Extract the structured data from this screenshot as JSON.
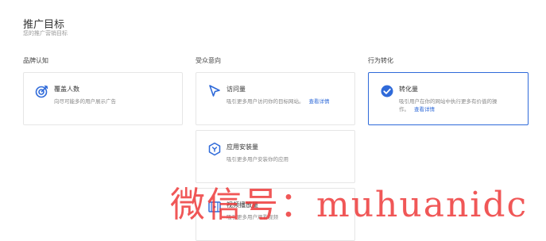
{
  "header": {
    "title": "推广目标",
    "subtitle": "您的推广营销目标"
  },
  "columns": [
    {
      "label": "品牌认知"
    },
    {
      "label": "受众意向"
    },
    {
      "label": "行为转化"
    }
  ],
  "cards": {
    "reach": {
      "title": "覆盖人数",
      "description": "向尽可能多的用户展示广告",
      "icon": "target-icon",
      "selected": false
    },
    "traffic": {
      "title": "访问量",
      "description": "吸引更多用户访问你的目标网站。",
      "link": "查看详情",
      "icon": "cursor-arrow-icon",
      "selected": false
    },
    "conversion": {
      "title": "转化量",
      "description_line1": "吸引用户在你的网站中执行更多有价值的操",
      "description_line2": "作。",
      "link": "查看详情",
      "icon": "check-circle-icon",
      "selected": true
    },
    "app_install": {
      "title": "应用安装量",
      "description": "吸引更多用户安装你的应用",
      "icon": "app-cube-icon",
      "selected": false
    },
    "video_views": {
      "title": "视频播放量",
      "description": "吸引更多用户观看视频",
      "icon": "film-icon",
      "selected": false
    }
  },
  "watermark": "微信号：muhuanidc",
  "colors": {
    "accent": "#2f6ad9",
    "watermark": "#ee3a3a",
    "border": "#e6e6e6"
  }
}
